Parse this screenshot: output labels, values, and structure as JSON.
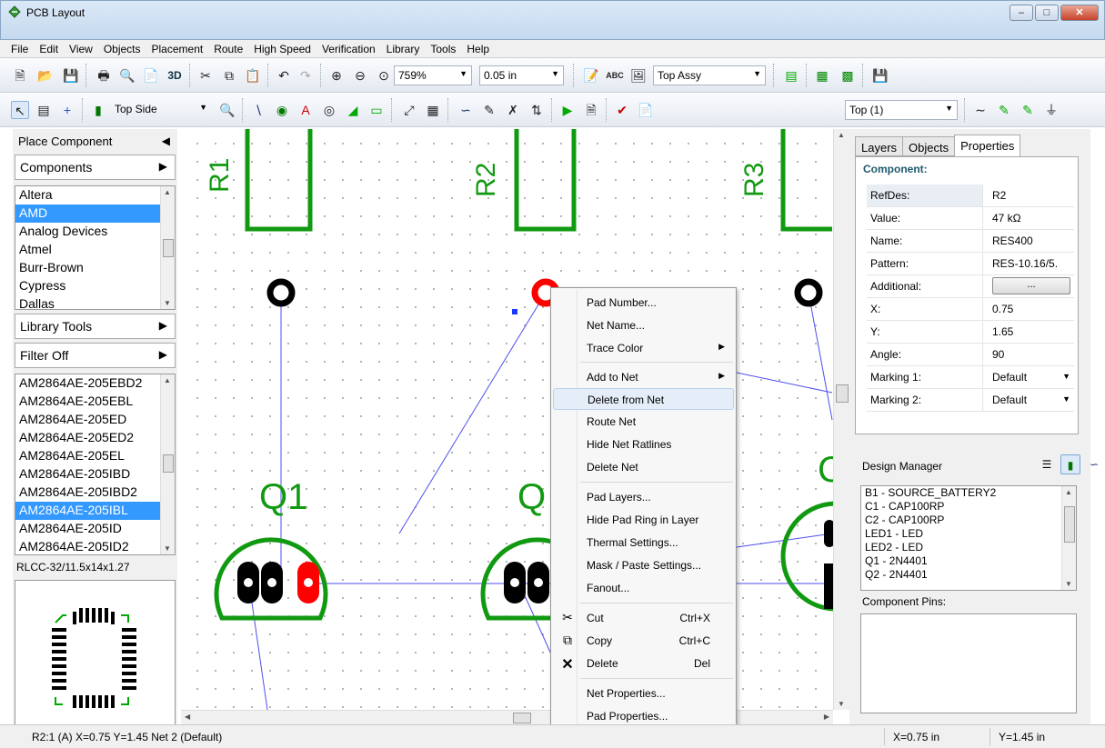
{
  "window": {
    "title": "PCB Layout",
    "buttons": {
      "minimize": "–",
      "maximize": "□",
      "close": "✕"
    }
  },
  "menu": [
    "File",
    "Edit",
    "View",
    "Objects",
    "Placement",
    "Route",
    "High Speed",
    "Verification",
    "Library",
    "Tools",
    "Help"
  ],
  "toolbar1": {
    "view3d_label": "3D",
    "zoom": "759%",
    "grid": "0.05 in",
    "assembly": "Top Assy",
    "text_tool_label": "ABC"
  },
  "toolbar2": {
    "side": "Top Side",
    "layer": "Top (1)"
  },
  "left_panel": {
    "place_component": "Place Component",
    "components_button": "Components",
    "manufacturers": [
      "Altera",
      "AMD",
      "Analog Devices",
      "Atmel",
      "Burr-Brown",
      "Cypress",
      "Dallas"
    ],
    "manufacturer_selected": "AMD",
    "library_tools": "Library Tools",
    "filter": "Filter Off",
    "parts": [
      "AM2864AE-205EBD2",
      "AM2864AE-205EBL",
      "AM2864AE-205ED",
      "AM2864AE-205ED2",
      "AM2864AE-205EL",
      "AM2864AE-205IBD",
      "AM2864AE-205IBD2",
      "AM2864AE-205IBL",
      "AM2864AE-205ID",
      "AM2864AE-205ID2"
    ],
    "part_selected": "AM2864AE-205IBL",
    "package": "RLCC-32/11.5x14x1.27"
  },
  "canvas": {
    "labels": {
      "r1": "R1",
      "r2": "R2",
      "r3": "R3",
      "q1": "Q1",
      "q2": "Q",
      "q3": "C"
    },
    "colors": {
      "copper": "#119a11",
      "pad": "#000000",
      "selected_pad": "#ff0000",
      "ratsnest": "#4e4ef0"
    }
  },
  "context_menu": {
    "items": [
      {
        "label": "Pad Number...",
        "shortcut": "",
        "submenu": false,
        "icon": ""
      },
      {
        "label": "Net Name...",
        "shortcut": "",
        "submenu": false,
        "icon": ""
      },
      {
        "label": "Trace Color",
        "shortcut": "",
        "submenu": true,
        "icon": ""
      },
      {
        "label": "Add to Net",
        "shortcut": "",
        "submenu": true,
        "icon": ""
      },
      {
        "label": "Delete from Net",
        "shortcut": "",
        "submenu": false,
        "icon": "",
        "highlighted": true
      },
      {
        "label": "Route Net",
        "shortcut": "",
        "submenu": false,
        "icon": ""
      },
      {
        "label": "Hide Net Ratlines",
        "shortcut": "",
        "submenu": false,
        "icon": ""
      },
      {
        "label": "Delete Net",
        "shortcut": "",
        "submenu": false,
        "icon": ""
      },
      {
        "label": "Pad Layers...",
        "shortcut": "",
        "submenu": false,
        "icon": ""
      },
      {
        "label": "Hide Pad Ring in Layer",
        "shortcut": "",
        "submenu": false,
        "icon": ""
      },
      {
        "label": "Thermal Settings...",
        "shortcut": "",
        "submenu": false,
        "icon": ""
      },
      {
        "label": "Mask / Paste Settings...",
        "shortcut": "",
        "submenu": false,
        "icon": ""
      },
      {
        "label": "Fanout...",
        "shortcut": "",
        "submenu": false,
        "icon": ""
      },
      {
        "label": "Cut",
        "shortcut": "Ctrl+X",
        "submenu": false,
        "icon": "scissors-icon"
      },
      {
        "label": "Copy",
        "shortcut": "Ctrl+C",
        "submenu": false,
        "icon": "copy-icon"
      },
      {
        "label": "Delete",
        "shortcut": "Del",
        "submenu": false,
        "icon": "delete-icon"
      },
      {
        "label": "Net Properties...",
        "shortcut": "",
        "submenu": false,
        "icon": ""
      },
      {
        "label": "Pad Properties...",
        "shortcut": "",
        "submenu": false,
        "icon": ""
      }
    ]
  },
  "right_panel": {
    "tabs": [
      "Layers",
      "Objects",
      "Properties"
    ],
    "active_tab": "Properties",
    "section": "Component:",
    "properties": [
      {
        "key": "RefDes:",
        "value": "R2"
      },
      {
        "key": "Value:",
        "value": "47 kΩ"
      },
      {
        "key": "Name:",
        "value": "RES400"
      },
      {
        "key": "Pattern:",
        "value": "RES-10.16/5."
      },
      {
        "key": "Additional:",
        "value": "..."
      },
      {
        "key": "X:",
        "value": "0.75"
      },
      {
        "key": "Y:",
        "value": "1.65"
      },
      {
        "key": "Angle:",
        "value": "90"
      },
      {
        "key": "Marking 1:",
        "value": "Default"
      },
      {
        "key": "Marking 2:",
        "value": "Default"
      }
    ],
    "design_manager": "Design Manager",
    "dm_items": [
      "B1 - SOURCE_BATTERY2",
      "C1 - CAP100RP",
      "C2 - CAP100RP",
      "LED1 - LED",
      "LED2 - LED",
      "Q1 - 2N4401",
      "Q2 - 2N4401"
    ],
    "component_pins": "Component Pins:"
  },
  "status": {
    "left": "R2:1 (A)  X=0.75  Y=1.45  Net 2 (Default)",
    "x": "X=0.75 in",
    "y": "Y=1.45 in"
  }
}
